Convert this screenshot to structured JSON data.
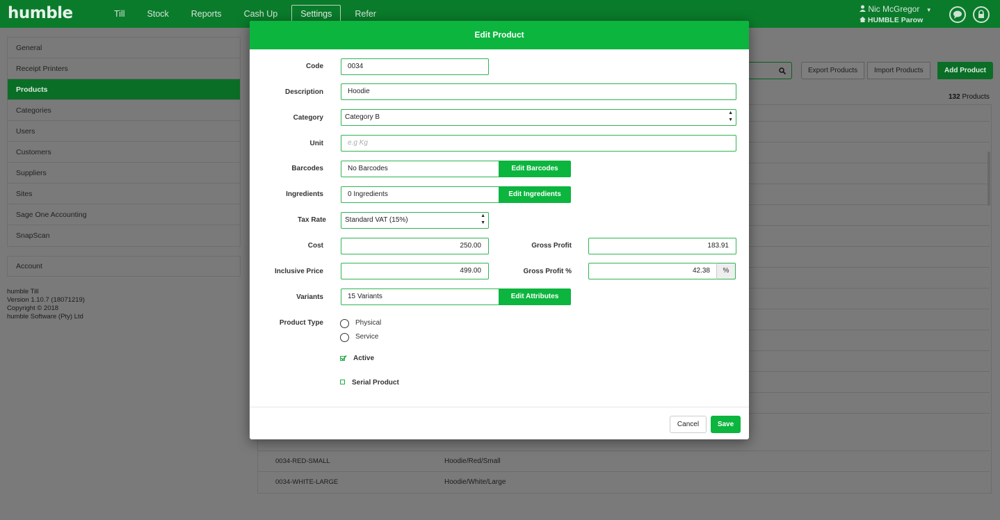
{
  "app": {
    "logo": "humble"
  },
  "nav": {
    "items": [
      {
        "label": "Till"
      },
      {
        "label": "Stock"
      },
      {
        "label": "Reports"
      },
      {
        "label": "Cash Up"
      },
      {
        "label": "Settings",
        "active": true
      },
      {
        "label": "Refer"
      }
    ]
  },
  "user": {
    "name": "Nic McGregor",
    "site": "HUMBLE Parow",
    "dropdown_icon": "caret-down-icon"
  },
  "sidebar": {
    "items": [
      {
        "label": "General"
      },
      {
        "label": "Receipt Printers"
      },
      {
        "label": "Products",
        "active": true
      },
      {
        "label": "Categories"
      },
      {
        "label": "Users"
      },
      {
        "label": "Customers"
      },
      {
        "label": "Suppliers"
      },
      {
        "label": "Sites"
      },
      {
        "label": "Sage One Accounting"
      },
      {
        "label": "SnapScan"
      }
    ],
    "account": "Account"
  },
  "about": {
    "name": "humble Till",
    "version": "Version 1.10.7 (18071219)",
    "copyright": "Copyright © 2018",
    "company": "humble Software (Pty) Ltd"
  },
  "toolbar": {
    "export": "Export Products",
    "import": "Import Products",
    "add": "Add Product",
    "count_number": "132",
    "count_label": "Products"
  },
  "background_rows": [
    {
      "code": "0034-RED-SMALL",
      "description": "Hoodie/Red/Small"
    },
    {
      "code": "0034-WHITE-LARGE",
      "description": "Hoodie/White/Large"
    }
  ],
  "modal": {
    "title": "Edit Product",
    "labels": {
      "code": "Code",
      "description": "Description",
      "category": "Category",
      "unit": "Unit",
      "barcodes": "Barcodes",
      "ingredients": "Ingredients",
      "tax_rate": "Tax Rate",
      "cost": "Cost",
      "gross_profit": "Gross Profit",
      "inclusive_price": "Inclusive Price",
      "gross_profit_pct": "Gross Profit %",
      "variants": "Variants",
      "product_type": "Product Type"
    },
    "values": {
      "code": "0034",
      "description": "Hoodie",
      "category": "Category B",
      "unit_placeholder": "e.g Kg",
      "barcodes": "No Barcodes",
      "ingredients": "0 Ingredients",
      "tax_rate": "Standard VAT (15%)",
      "cost": "250.00",
      "gross_profit": "183.91",
      "inclusive_price": "499.00",
      "gross_profit_pct": "42.38",
      "pct_addon": "%",
      "variants": "15 Variants"
    },
    "buttons": {
      "edit_barcodes": "Edit Barcodes",
      "edit_ingredients": "Edit Ingredients",
      "edit_attributes": "Edit Attributes",
      "cancel": "Cancel",
      "save": "Save"
    },
    "product_type_options": [
      "Physical",
      "Service"
    ],
    "active": {
      "label": "Active",
      "checked": true
    },
    "serial": {
      "label": "Serial Product",
      "checked": false
    }
  },
  "colors": {
    "brand": "#0a7b2b",
    "accent": "#0cb53e"
  }
}
